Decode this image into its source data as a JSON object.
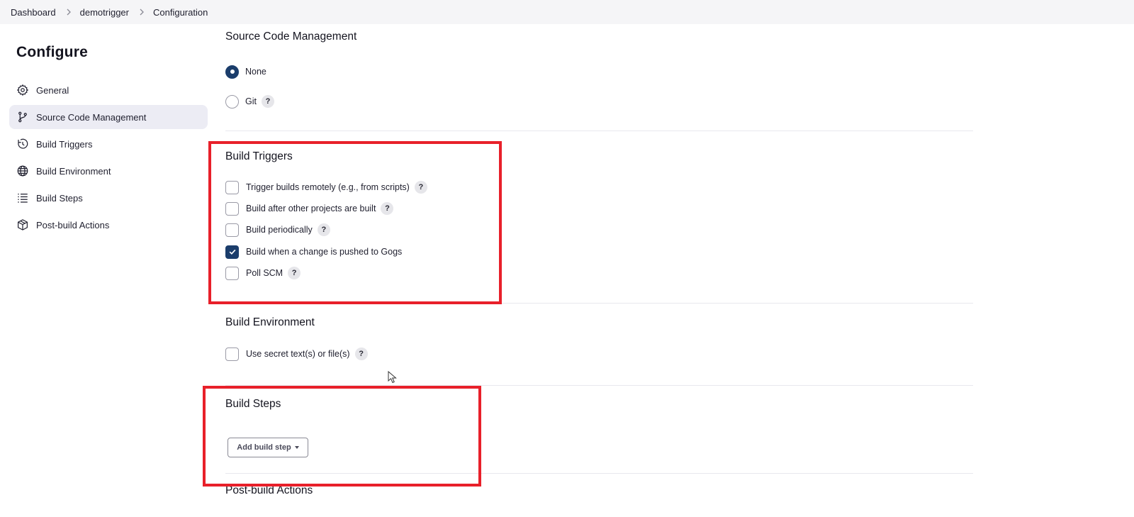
{
  "breadcrumb": {
    "items": [
      "Dashboard",
      "demotrigger",
      "Configuration"
    ]
  },
  "sidebar": {
    "title": "Configure",
    "items": [
      {
        "label": "General",
        "icon": "gear-icon"
      },
      {
        "label": "Source Code Management",
        "icon": "branch-icon",
        "active": true
      },
      {
        "label": "Build Triggers",
        "icon": "clock-icon"
      },
      {
        "label": "Build Environment",
        "icon": "globe-icon"
      },
      {
        "label": "Build Steps",
        "icon": "list-icon"
      },
      {
        "label": "Post-build Actions",
        "icon": "package-icon"
      }
    ]
  },
  "scm": {
    "title": "Source Code Management",
    "options": [
      {
        "label": "None",
        "selected": true
      },
      {
        "label": "Git",
        "selected": false,
        "help": "?"
      }
    ]
  },
  "triggers": {
    "title": "Build Triggers",
    "options": [
      {
        "label": "Trigger builds remotely (e.g., from scripts)",
        "checked": false,
        "help": "?"
      },
      {
        "label": "Build after other projects are built",
        "checked": false,
        "help": "?"
      },
      {
        "label": "Build periodically",
        "checked": false,
        "help": "?"
      },
      {
        "label": "Build when a change is pushed to Gogs",
        "checked": true
      },
      {
        "label": "Poll SCM",
        "checked": false,
        "help": "?"
      }
    ]
  },
  "environment": {
    "title": "Build Environment",
    "options": [
      {
        "label": "Use secret text(s) or file(s)",
        "checked": false,
        "help": "?"
      }
    ]
  },
  "steps": {
    "title": "Build Steps",
    "add_button": "Add build step"
  },
  "post_build": {
    "title": "Post-build Actions"
  },
  "colors": {
    "accent": "#1b3d6b",
    "highlight": "#e8202a",
    "active_nav": "#ececf4"
  }
}
